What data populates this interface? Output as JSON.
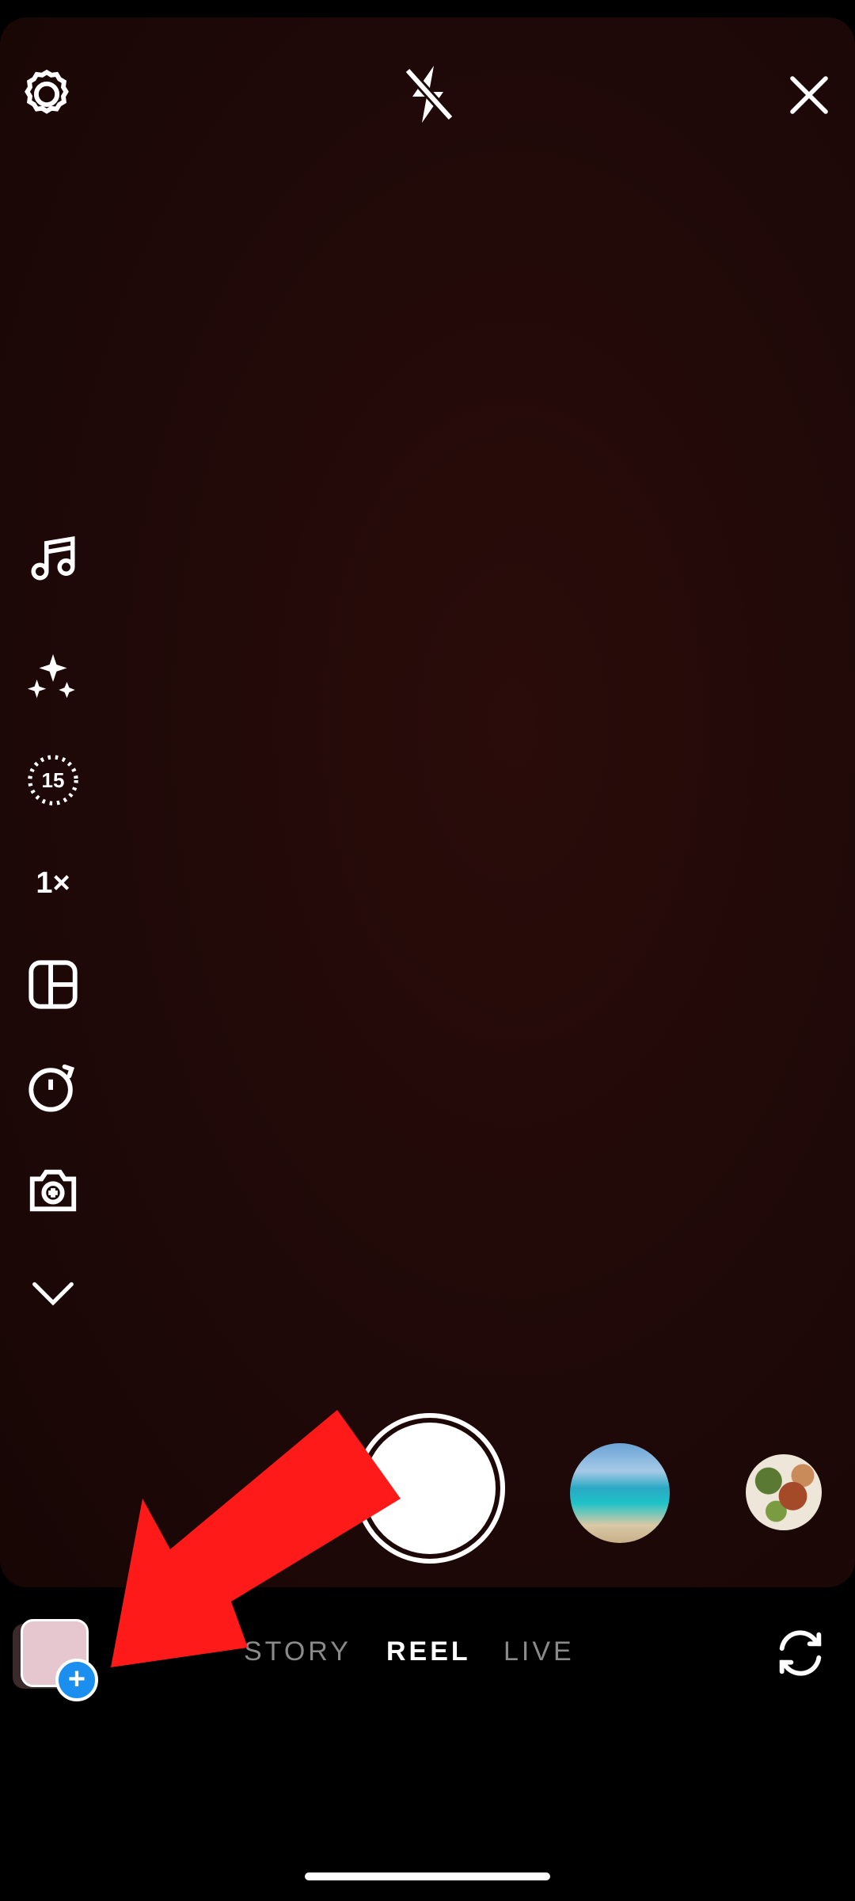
{
  "top_bar": {
    "settings_icon": "gear-icon",
    "flash_icon": "flash-off-icon",
    "close_icon": "close-icon"
  },
  "side_tools": [
    {
      "name": "music",
      "icon": "music-note-icon"
    },
    {
      "name": "effects",
      "icon": "sparkles-icon"
    },
    {
      "name": "length",
      "icon": "timer-15-icon",
      "label": "15"
    },
    {
      "name": "speed",
      "icon": "speed-icon",
      "label": "1×"
    },
    {
      "name": "layout",
      "icon": "layout-icon"
    },
    {
      "name": "countdown",
      "icon": "countdown-timer-icon"
    },
    {
      "name": "dual-camera",
      "icon": "camera-plus-icon"
    },
    {
      "name": "more",
      "icon": "chevron-down-icon"
    }
  ],
  "capture": {
    "shutter": "shutter-button",
    "effect_thumbnails": [
      "beach-thumbnail",
      "food-thumbnail"
    ]
  },
  "modes": {
    "items": [
      "STORY",
      "REEL",
      "LIVE"
    ],
    "selected": "REEL"
  },
  "bottom": {
    "gallery_icon": "gallery-thumbnail",
    "badge": "+",
    "flip_camera_icon": "flip-camera-icon"
  },
  "colors": {
    "viewfinder": "#1f0908",
    "annotation_arrow": "#ff1a1a",
    "badge_blue": "#1b8ff0"
  }
}
